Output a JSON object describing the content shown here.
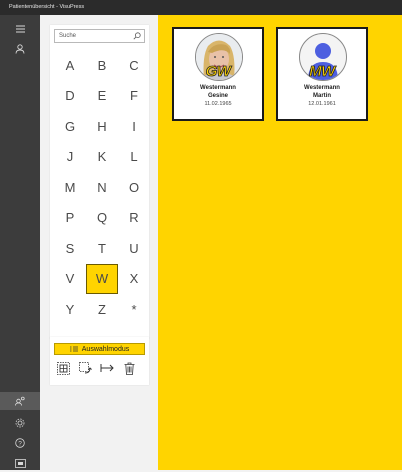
{
  "window": {
    "title": "Patientenübersicht - VisuPress"
  },
  "rail": {
    "items": [
      {
        "icon": "menu-icon"
      },
      {
        "icon": "person-icon"
      }
    ],
    "bottom_items": [
      {
        "icon": "user-switch-icon"
      },
      {
        "icon": "gear-icon"
      },
      {
        "icon": "help-icon"
      },
      {
        "icon": "screen-icon"
      }
    ]
  },
  "search": {
    "placeholder": "Suche"
  },
  "alphabet": {
    "letters": [
      "A",
      "B",
      "C",
      "D",
      "E",
      "F",
      "G",
      "H",
      "I",
      "J",
      "K",
      "L",
      "M",
      "N",
      "O",
      "P",
      "Q",
      "R",
      "S",
      "T",
      "U",
      "V",
      "W",
      "X",
      "Y",
      "Z",
      "*"
    ],
    "selected": "W"
  },
  "mode": {
    "label": "Auswahlmodus",
    "accent": "#ffd400"
  },
  "patients": [
    {
      "initials": "GW",
      "last_name": "Westermann",
      "first_name": "Gesine",
      "dob": "11.02.1965",
      "avatar": "photo"
    },
    {
      "initials": "MW",
      "last_name": "Westermann",
      "first_name": "Martin",
      "dob": "12.01.1961",
      "avatar": "placeholder-person"
    }
  ],
  "colors": {
    "accent": "#ffd400",
    "rail": "#3c3c3c",
    "titlebar": "#2b2b2b"
  }
}
